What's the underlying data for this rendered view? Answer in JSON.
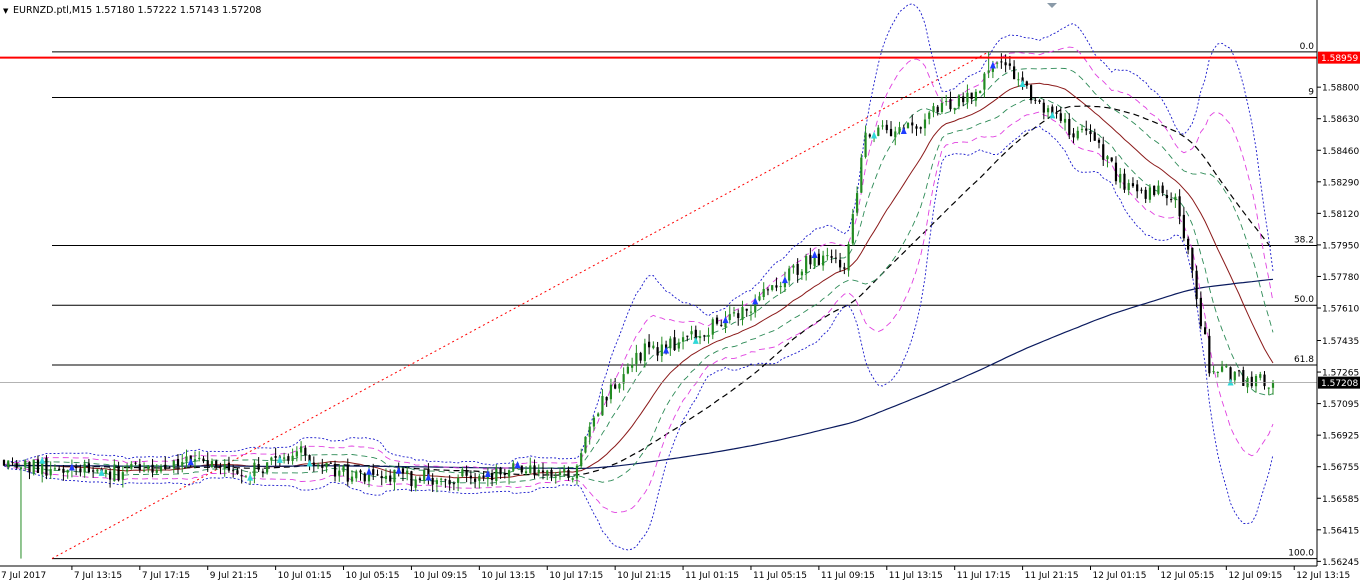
{
  "header": {
    "menu_arrow_glyph": "▼",
    "text": "EURNZD.ptl,M15  1.57180 1.57222 1.57143 1.57208"
  },
  "chart_data": {
    "type": "candlestick",
    "symbol": "EURNZD.ptl",
    "timeframe": "M15",
    "ohlc_header": {
      "open": 1.5718,
      "high": 1.57222,
      "low": 1.57143,
      "close": 1.57208
    },
    "ylim": [
      1.5622,
      1.59178
    ],
    "price_ticks": [
      "1.58800",
      "1.58630",
      "1.58460",
      "1.58290",
      "1.58120",
      "1.57950",
      "1.57780",
      "1.57610",
      "1.57435",
      "1.57265",
      "1.57095",
      "1.56925",
      "1.56755",
      "1.56585",
      "1.56415",
      "1.56245"
    ],
    "time_ticks": [
      "7 Jul 2017",
      "7 Jul 13:15",
      "7 Jul 17:15",
      "9 Jul 21:15",
      "10 Jul 01:15",
      "10 Jul 05:15",
      "10 Jul 09:15",
      "10 Jul 13:15",
      "10 Jul 17:15",
      "10 Jul 21:15",
      "11 Jul 01:15",
      "11 Jul 05:15",
      "11 Jul 09:15",
      "11 Jul 13:15",
      "11 Jul 17:15",
      "11 Jul 21:15",
      "12 Jul 01:15",
      "12 Jul 05:15",
      "12 Jul 09:15",
      "12 Jul 13:15"
    ],
    "bars_count": 300,
    "current_price": {
      "label": "1.57208",
      "value": 1.57208,
      "color": "#000000"
    },
    "horizontal_line": {
      "label": "1.58959",
      "value": 1.58959,
      "color": "#ff0000"
    },
    "fibonacci": {
      "high": 1.5899,
      "low": 1.5626,
      "levels": [
        {
          "label": "0.0",
          "value": 1.5899
        },
        {
          "label": "9",
          "value": 1.58744
        },
        {
          "label": "38.2",
          "value": 1.57947
        },
        {
          "label": "50.0",
          "value": 1.57625
        },
        {
          "label": "61.8",
          "value": 1.57303
        },
        {
          "label": "100.0",
          "value": 1.5626
        }
      ],
      "trend_line": {
        "from_bar": 0,
        "from_value": 1.5626,
        "to_bar": 232,
        "to_value": 1.5899,
        "color": "#ff0000",
        "style": "dotted"
      }
    },
    "anchor_path": [
      [
        0,
        1.5677
      ],
      [
        14,
        1.5674
      ],
      [
        28,
        1.5672
      ],
      [
        42,
        1.5678
      ],
      [
        58,
        1.5672
      ],
      [
        68,
        1.5684
      ],
      [
        80,
        1.5672
      ],
      [
        96,
        1.5669
      ],
      [
        112,
        1.567
      ],
      [
        124,
        1.5675
      ],
      [
        134,
        1.5671
      ],
      [
        139,
        1.5705
      ],
      [
        150,
        1.5737
      ],
      [
        162,
        1.5745
      ],
      [
        174,
        1.576
      ],
      [
        180,
        1.577
      ],
      [
        190,
        1.5788
      ],
      [
        198,
        1.5786
      ],
      [
        203,
        1.5855
      ],
      [
        212,
        1.5855
      ],
      [
        222,
        1.587
      ],
      [
        230,
        1.588
      ],
      [
        235,
        1.5895
      ],
      [
        246,
        1.5866
      ],
      [
        258,
        1.5848
      ],
      [
        264,
        1.5825
      ],
      [
        272,
        1.5823
      ],
      [
        276,
        1.582
      ],
      [
        280,
        1.578
      ],
      [
        284,
        1.573
      ],
      [
        290,
        1.5723
      ],
      [
        299,
        1.5721
      ]
    ],
    "indicators": [
      {
        "name": "",
        "type": "ma",
        "period": 20,
        "color": "#8b1a1a",
        "style": "solid"
      },
      {
        "name": "",
        "type": "ma",
        "period": 50,
        "color": "#000000",
        "style": "dashed"
      },
      {
        "name": "",
        "type": "ma",
        "period": 200,
        "color": "#0a1a5e",
        "style": "solid"
      },
      {
        "name": "",
        "type": "bands",
        "period": 20,
        "deviation": 1.0,
        "color": "#2e8b57",
        "style": "dashed"
      },
      {
        "name": "",
        "type": "bands",
        "period": 20,
        "deviation": 2.0,
        "color": "#e040e0",
        "style": "dashed"
      },
      {
        "name": "",
        "type": "bands",
        "period": 20,
        "deviation": 3.0,
        "color": "#1a1acc",
        "style": "dotted"
      }
    ],
    "marker_colors": {
      "cyan": "#30d8d8",
      "blue": "#1e3cff"
    },
    "grid": false
  },
  "colors": {
    "bull": "#228b22",
    "bear": "#000000",
    "axis": "#000000",
    "background": "#ffffff"
  }
}
